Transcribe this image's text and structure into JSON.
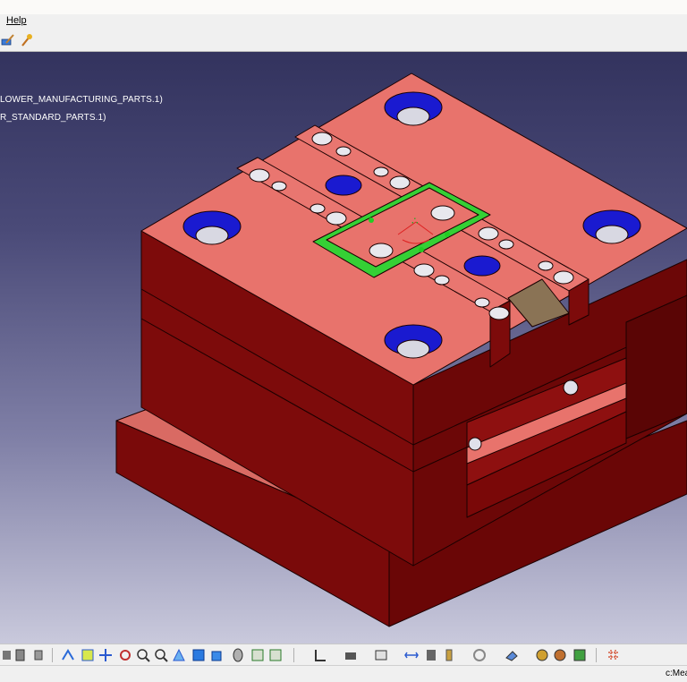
{
  "menu": {
    "help": "Help"
  },
  "tree": {
    "line1": "LOWER_MANUFACTURING_PARTS.1)",
    "line2": "R_STANDARD_PARTS.1)"
  },
  "status": {
    "command_input": "c:Mea"
  },
  "toolbar_icons": [
    "brush-icon",
    "paint-icon"
  ],
  "bottom_toolbar_icons": [
    "dock-icon",
    "parts-icon",
    "fly-icon",
    "fit-all-icon",
    "pan-icon",
    "rotate-icon",
    "zoom-in-icon",
    "zoom-out-icon",
    "normal-view-icon",
    "multi-view-icon",
    "iso-view-icon",
    "shading-icon",
    "hide-show-icon",
    "swap-space-icon",
    "measure-icon",
    "snap-icon",
    "camera-icon",
    "analysis-icon",
    "measure-between-icon",
    "mold-icon",
    "drill-icon",
    "link-icon",
    "eraser-icon",
    "material-icon",
    "sphere-icon",
    "grid-icon"
  ],
  "colors": {
    "plate_top": "#e8736c",
    "plate_side": "#7a0a0a",
    "core_green": "#22cc22",
    "hole_blue": "#1a1ad0"
  }
}
